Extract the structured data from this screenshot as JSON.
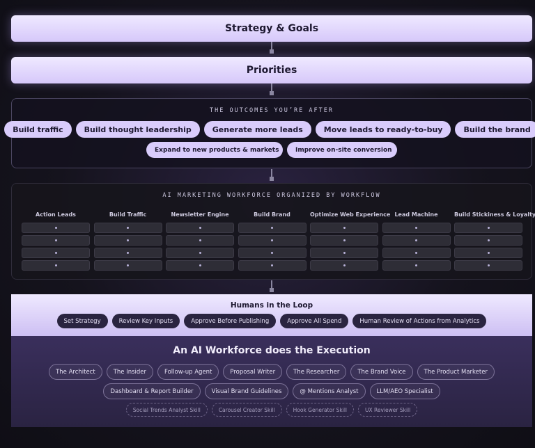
{
  "strategy_bar": {
    "label": "Strategy & Goals"
  },
  "priorities_bar": {
    "label": "Priorities"
  },
  "outcomes": {
    "title": "THE OUTCOMES YOU’RE AFTER",
    "primary": [
      "Build traffic",
      "Build thought leadership",
      "Generate more leads",
      "Move leads to ready-to-buy",
      "Build the brand"
    ],
    "secondary": [
      "Expand to new products & markets",
      "Improve on-site conversion"
    ]
  },
  "workforce": {
    "title": "AI MARKETING WORKFORCE ORGANIZED BY WORKFLOW",
    "columns": [
      "Action Leads",
      "Build Traffic",
      "Newsletter Engine",
      "Build Brand",
      "Optimize Web Experience",
      "Lead Machine",
      "Build Stickiness & Loyalty"
    ]
  },
  "humans": {
    "title": "Humans in the Loop",
    "items": [
      "Set Strategy",
      "Review Key Inputs",
      "Approve Before Publishing",
      "Approve All Spend",
      "Human Review of Actions from Analytics"
    ]
  },
  "execution": {
    "title": "An AI Workforce does the Execution",
    "row1": [
      "The Architect",
      "The Insider",
      "Follow-up Agent",
      "Proposal Writer",
      "The Researcher",
      "The Brand Voice",
      "The Product Marketer"
    ],
    "row2": [
      "Dashboard & Report Builder",
      "Visual Brand Guidelines",
      "@ Mentions Analyst",
      "LLM/AEO Specialist"
    ],
    "skills": [
      "Social Trends Analyst Skill",
      "Carousel Creator Skill",
      "Hook Generator Skill",
      "UX Reviewer Skill"
    ]
  }
}
